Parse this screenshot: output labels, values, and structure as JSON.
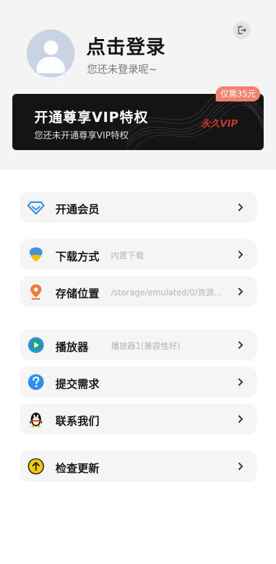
{
  "profile": {
    "title": "点击登录",
    "subtitle": "您还未登录呢~"
  },
  "vip": {
    "title": "开通尊享VIP特权",
    "subtitle": "您还未开通尊享VIP特权",
    "logo": "永久VIP",
    "price_tag": "仅需35元"
  },
  "menu": [
    {
      "label": "开通会员",
      "hint": "",
      "icon": "diamond-icon"
    },
    {
      "label": "下载方式",
      "hint": "内置下载",
      "icon": "download-icon"
    },
    {
      "label": "存储位置",
      "hint": "/storage/emulated/0/资源...",
      "icon": "location-pin-icon"
    },
    {
      "label": "播放器",
      "hint": "播放器1(兼容性好)",
      "icon": "play-icon"
    },
    {
      "label": "提交需求",
      "hint": "",
      "icon": "question-icon"
    },
    {
      "label": "联系我们",
      "hint": "",
      "icon": "qq-penguin-icon"
    },
    {
      "label": "检查更新",
      "hint": "",
      "icon": "update-arrow-icon"
    }
  ],
  "colors": {
    "accent_blue": "#2f8ef0",
    "price_tag": "#f3836e",
    "vip_card": "#141414",
    "update_yellow": "#f7c900"
  }
}
